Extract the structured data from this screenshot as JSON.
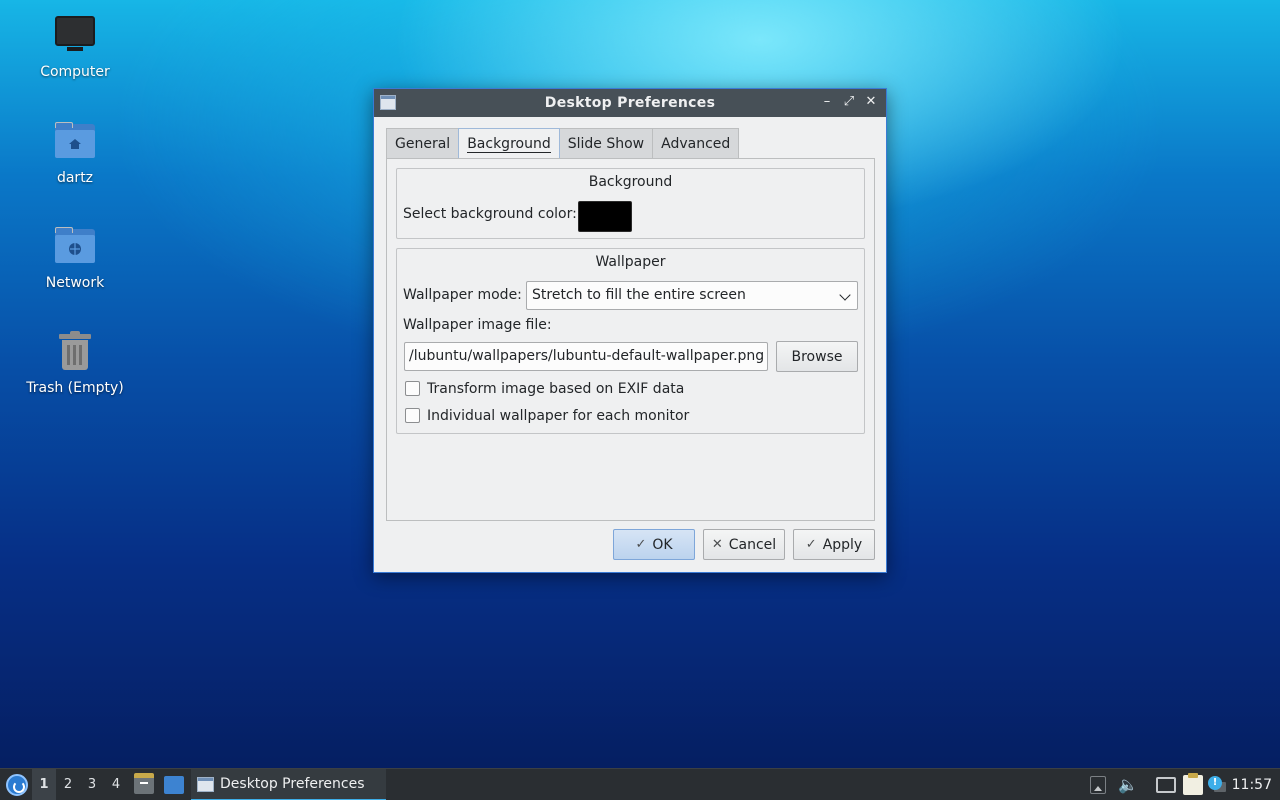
{
  "desktop": {
    "icons": [
      {
        "label": "Computer",
        "icon": "computer-icon"
      },
      {
        "label": "dartz",
        "icon": "home-folder-icon"
      },
      {
        "label": "Network",
        "icon": "network-folder-icon"
      },
      {
        "label": "Trash (Empty)",
        "icon": "trash-icon"
      }
    ]
  },
  "window": {
    "title": "Desktop Preferences",
    "controls": {
      "minimize": "–",
      "maximize": "⤢",
      "close": "✕"
    },
    "tabs": [
      {
        "label": "General",
        "active": false
      },
      {
        "label": "Background",
        "active": true
      },
      {
        "label": "Slide Show",
        "active": false
      },
      {
        "label": "Advanced",
        "active": false
      }
    ],
    "background_group": {
      "title": "Background",
      "color_label": "Select background color:",
      "color_value": "#000000"
    },
    "wallpaper_group": {
      "title": "Wallpaper",
      "mode_label": "Wallpaper mode:",
      "mode_value": "Stretch to fill the entire screen",
      "file_label": "Wallpaper image file:",
      "file_value": "/lubuntu/wallpapers/lubuntu-default-wallpaper.png",
      "browse_label": "Browse",
      "exif_label": "Transform image based on EXIF data",
      "exif_checked": false,
      "per_monitor_label": "Individual wallpaper for each monitor",
      "per_monitor_checked": false
    },
    "buttons": {
      "ok": "OK",
      "cancel": "Cancel",
      "apply": "Apply"
    }
  },
  "taskbar": {
    "desktops": [
      "1",
      "2",
      "3",
      "4"
    ],
    "active_desktop": "1",
    "task_label": "Desktop Preferences",
    "clock": "11:57"
  },
  "colors": {
    "accent": "#3daee9",
    "titlebar": "#475057",
    "taskbar": "#2a2e32"
  }
}
